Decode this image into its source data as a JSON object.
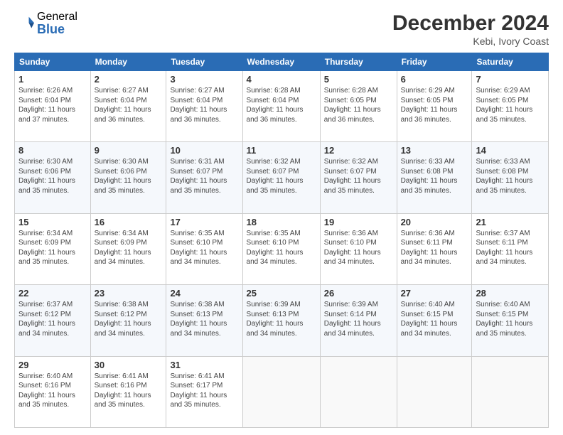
{
  "logo": {
    "general": "General",
    "blue": "Blue"
  },
  "header": {
    "title": "December 2024",
    "location": "Kebi, Ivory Coast"
  },
  "weekdays": [
    "Sunday",
    "Monday",
    "Tuesday",
    "Wednesday",
    "Thursday",
    "Friday",
    "Saturday"
  ],
  "weeks": [
    [
      {
        "day": "1",
        "info": "Sunrise: 6:26 AM\nSunset: 6:04 PM\nDaylight: 11 hours\nand 37 minutes."
      },
      {
        "day": "2",
        "info": "Sunrise: 6:27 AM\nSunset: 6:04 PM\nDaylight: 11 hours\nand 36 minutes."
      },
      {
        "day": "3",
        "info": "Sunrise: 6:27 AM\nSunset: 6:04 PM\nDaylight: 11 hours\nand 36 minutes."
      },
      {
        "day": "4",
        "info": "Sunrise: 6:28 AM\nSunset: 6:04 PM\nDaylight: 11 hours\nand 36 minutes."
      },
      {
        "day": "5",
        "info": "Sunrise: 6:28 AM\nSunset: 6:05 PM\nDaylight: 11 hours\nand 36 minutes."
      },
      {
        "day": "6",
        "info": "Sunrise: 6:29 AM\nSunset: 6:05 PM\nDaylight: 11 hours\nand 36 minutes."
      },
      {
        "day": "7",
        "info": "Sunrise: 6:29 AM\nSunset: 6:05 PM\nDaylight: 11 hours\nand 35 minutes."
      }
    ],
    [
      {
        "day": "8",
        "info": "Sunrise: 6:30 AM\nSunset: 6:06 PM\nDaylight: 11 hours\nand 35 minutes."
      },
      {
        "day": "9",
        "info": "Sunrise: 6:30 AM\nSunset: 6:06 PM\nDaylight: 11 hours\nand 35 minutes."
      },
      {
        "day": "10",
        "info": "Sunrise: 6:31 AM\nSunset: 6:07 PM\nDaylight: 11 hours\nand 35 minutes."
      },
      {
        "day": "11",
        "info": "Sunrise: 6:32 AM\nSunset: 6:07 PM\nDaylight: 11 hours\nand 35 minutes."
      },
      {
        "day": "12",
        "info": "Sunrise: 6:32 AM\nSunset: 6:07 PM\nDaylight: 11 hours\nand 35 minutes."
      },
      {
        "day": "13",
        "info": "Sunrise: 6:33 AM\nSunset: 6:08 PM\nDaylight: 11 hours\nand 35 minutes."
      },
      {
        "day": "14",
        "info": "Sunrise: 6:33 AM\nSunset: 6:08 PM\nDaylight: 11 hours\nand 35 minutes."
      }
    ],
    [
      {
        "day": "15",
        "info": "Sunrise: 6:34 AM\nSunset: 6:09 PM\nDaylight: 11 hours\nand 35 minutes."
      },
      {
        "day": "16",
        "info": "Sunrise: 6:34 AM\nSunset: 6:09 PM\nDaylight: 11 hours\nand 34 minutes."
      },
      {
        "day": "17",
        "info": "Sunrise: 6:35 AM\nSunset: 6:10 PM\nDaylight: 11 hours\nand 34 minutes."
      },
      {
        "day": "18",
        "info": "Sunrise: 6:35 AM\nSunset: 6:10 PM\nDaylight: 11 hours\nand 34 minutes."
      },
      {
        "day": "19",
        "info": "Sunrise: 6:36 AM\nSunset: 6:10 PM\nDaylight: 11 hours\nand 34 minutes."
      },
      {
        "day": "20",
        "info": "Sunrise: 6:36 AM\nSunset: 6:11 PM\nDaylight: 11 hours\nand 34 minutes."
      },
      {
        "day": "21",
        "info": "Sunrise: 6:37 AM\nSunset: 6:11 PM\nDaylight: 11 hours\nand 34 minutes."
      }
    ],
    [
      {
        "day": "22",
        "info": "Sunrise: 6:37 AM\nSunset: 6:12 PM\nDaylight: 11 hours\nand 34 minutes."
      },
      {
        "day": "23",
        "info": "Sunrise: 6:38 AM\nSunset: 6:12 PM\nDaylight: 11 hours\nand 34 minutes."
      },
      {
        "day": "24",
        "info": "Sunrise: 6:38 AM\nSunset: 6:13 PM\nDaylight: 11 hours\nand 34 minutes."
      },
      {
        "day": "25",
        "info": "Sunrise: 6:39 AM\nSunset: 6:13 PM\nDaylight: 11 hours\nand 34 minutes."
      },
      {
        "day": "26",
        "info": "Sunrise: 6:39 AM\nSunset: 6:14 PM\nDaylight: 11 hours\nand 34 minutes."
      },
      {
        "day": "27",
        "info": "Sunrise: 6:40 AM\nSunset: 6:15 PM\nDaylight: 11 hours\nand 34 minutes."
      },
      {
        "day": "28",
        "info": "Sunrise: 6:40 AM\nSunset: 6:15 PM\nDaylight: 11 hours\nand 35 minutes."
      }
    ],
    [
      {
        "day": "29",
        "info": "Sunrise: 6:40 AM\nSunset: 6:16 PM\nDaylight: 11 hours\nand 35 minutes."
      },
      {
        "day": "30",
        "info": "Sunrise: 6:41 AM\nSunset: 6:16 PM\nDaylight: 11 hours\nand 35 minutes."
      },
      {
        "day": "31",
        "info": "Sunrise: 6:41 AM\nSunset: 6:17 PM\nDaylight: 11 hours\nand 35 minutes."
      },
      null,
      null,
      null,
      null
    ]
  ]
}
